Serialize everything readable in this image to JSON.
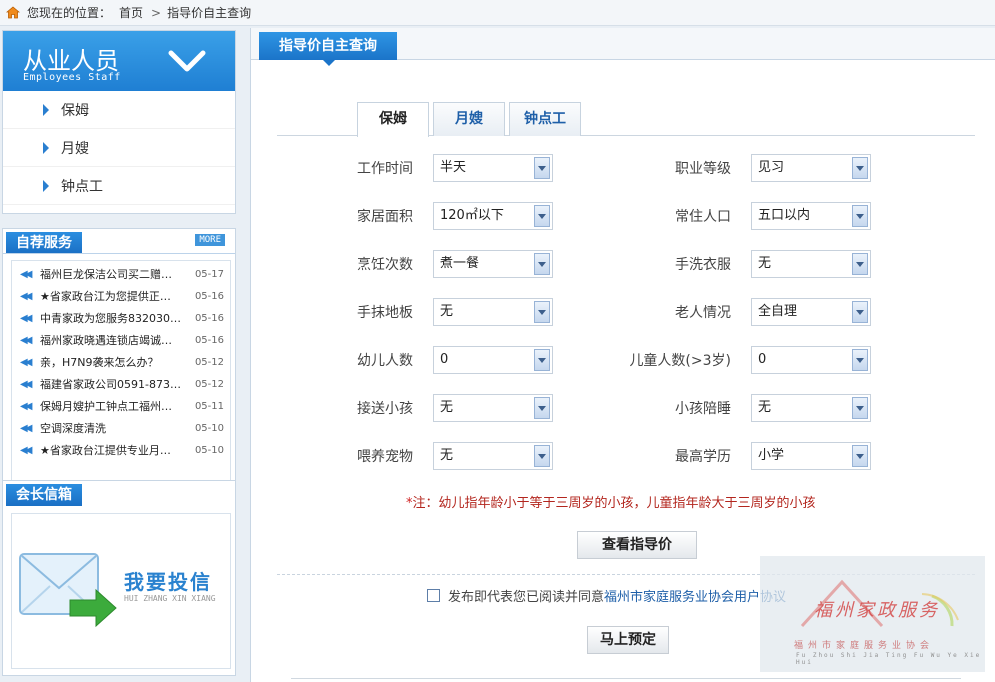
{
  "breadcrumb": {
    "prefix": "您现在的位置：",
    "home": "首页",
    "separator": ">",
    "current": "指导价自主查询"
  },
  "sidebar": {
    "staff": {
      "title_cn": "从业人员",
      "title_en": "Employees Staff",
      "items": [
        "保姆",
        "月嫂",
        "钟点工"
      ]
    },
    "service": {
      "title": "自荐服务",
      "more": "MORE",
      "items": [
        {
          "title": "福州巨龙保洁公司买二赠…",
          "date": "05-17"
        },
        {
          "title": "★省家政台江为您提供正…",
          "date": "05-16"
        },
        {
          "title": "中青家政为您服务832030…",
          "date": "05-16"
        },
        {
          "title": "福州家政晓遇连锁店竭诚…",
          "date": "05-16"
        },
        {
          "title": "亲，H7N9袭来怎么办？",
          "date": "05-12"
        },
        {
          "title": "福建省家政公司0591-873…",
          "date": "05-12"
        },
        {
          "title": "保姆月嫂护工钟点工福州…",
          "date": "05-11"
        },
        {
          "title": "空调深度清洗",
          "date": "05-10"
        },
        {
          "title": "★省家政台江提供专业月…",
          "date": "05-10"
        }
      ]
    },
    "mailbox": {
      "title": "会长信箱",
      "banner_cn": "我要投信",
      "banner_en": "HUI ZHANG XIN XIANG"
    }
  },
  "main": {
    "section_title": "指导价自主查询",
    "tabs": [
      "保姆",
      "月嫂",
      "钟点工"
    ],
    "active_tab": "保姆",
    "left_fields": [
      {
        "label": "工作时间",
        "value": "半天"
      },
      {
        "label": "家居面积",
        "value": "120㎡以下"
      },
      {
        "label": "烹饪次数",
        "value": "煮一餐"
      },
      {
        "label": "手抹地板",
        "value": "无"
      },
      {
        "label": "幼儿人数",
        "value": "0"
      },
      {
        "label": "接送小孩",
        "value": "无"
      },
      {
        "label": "喂养宠物",
        "value": "无"
      }
    ],
    "right_fields": [
      {
        "label": "职业等级",
        "value": "见习"
      },
      {
        "label": "常住人口",
        "value": "五口以内"
      },
      {
        "label": "手洗衣服",
        "value": "无"
      },
      {
        "label": "老人情况",
        "value": "全自理"
      },
      {
        "label": "儿童人数(>3岁)",
        "value": "0"
      },
      {
        "label": "小孩陪睡",
        "value": "无"
      },
      {
        "label": "最高学历",
        "value": "小学"
      }
    ],
    "note_star": "*",
    "note": "注：幼儿指年龄小于等于三周岁的小孩，儿童指年龄大于三周岁的小孩",
    "query_button": "查看指导价",
    "agree_text": "发布即代表您已阅读并同意",
    "agree_link": "福州市家庭服务业协会用户协议",
    "book_button": "马上预定"
  },
  "watermark": {
    "cn": "福州家政服务",
    "sub_cn": "福州市家庭服务业协会",
    "sub_en": "Fu Zhou Shi Jia Ting Fu Wu Ye Xie Hui"
  },
  "colors": {
    "accent": "#1b74c9",
    "link": "#1e5fa8",
    "note": "#b3261e",
    "background": "#e9eff5"
  }
}
